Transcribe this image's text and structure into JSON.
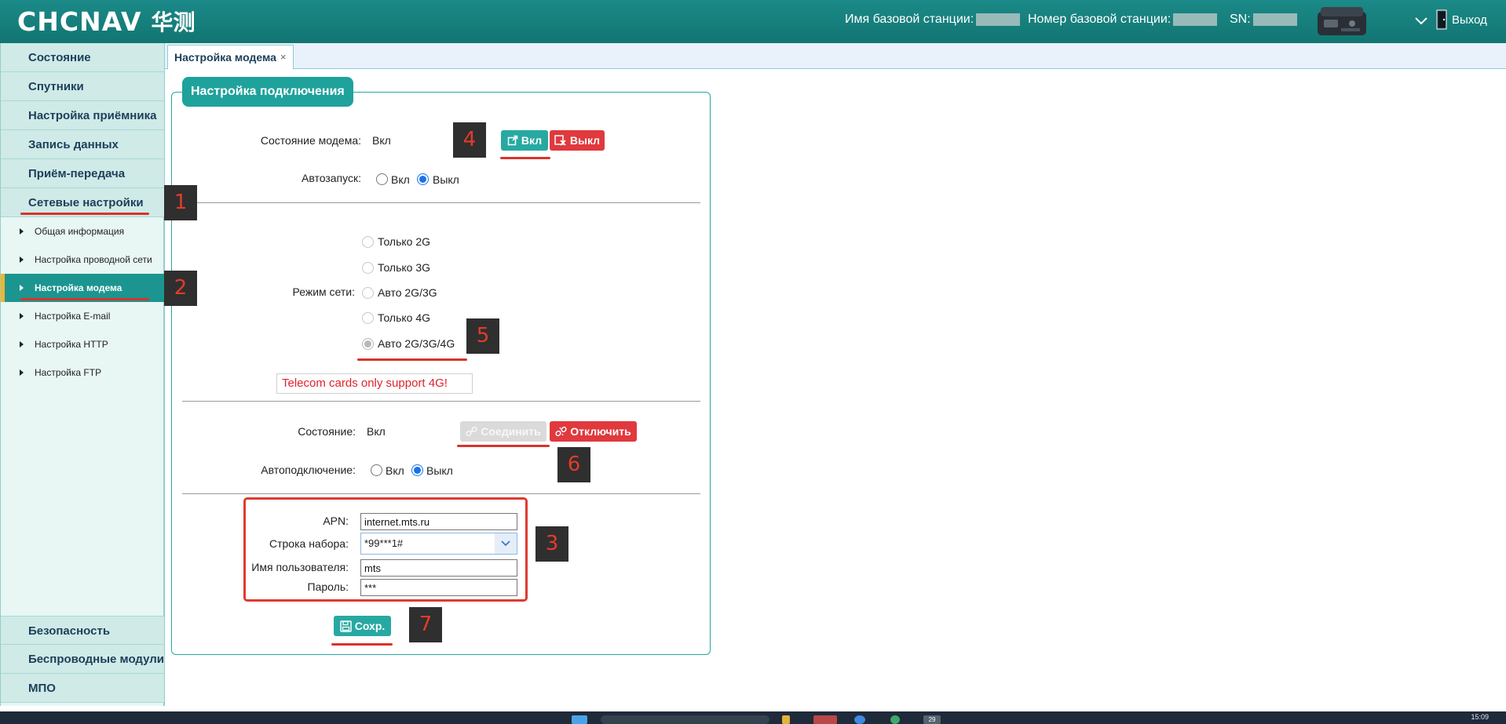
{
  "header": {
    "logo_text": "CHCNAV",
    "logo_cn": "华测",
    "base_name_label": "Имя базовой станции:",
    "base_number_label": "Номер базовой станции:",
    "sn_label": "SN:",
    "logout_label": "Выход"
  },
  "sidebar": {
    "top_items": [
      {
        "label": "Состояние"
      },
      {
        "label": "Спутники"
      },
      {
        "label": "Настройка приёмника"
      },
      {
        "label": "Запись данных"
      },
      {
        "label": "Приём-передача"
      },
      {
        "label": "Сетевые настройки"
      }
    ],
    "sub_items": [
      {
        "label": "Общая информация"
      },
      {
        "label": "Настройка проводной сети"
      },
      {
        "label": "Настройка модема",
        "active": true
      },
      {
        "label": "Настройка E-mail"
      },
      {
        "label": "Настройка HTTP"
      },
      {
        "label": "Настройка FTP"
      }
    ],
    "bottom_items": [
      {
        "label": "Безопасность"
      },
      {
        "label": "Беспроводные модули"
      },
      {
        "label": "МПО"
      }
    ]
  },
  "tabs": [
    {
      "label": "Настройка модема",
      "close": "×"
    }
  ],
  "panel": {
    "title": "Настройка подключения",
    "modem_state_label": "Состояние модема:",
    "modem_state_value": "Вкл",
    "btn_on": "Вкл",
    "btn_off": "Выкл",
    "autostart_label": "Автозапуск:",
    "autostart_on": "Вкл",
    "autostart_off": "Выкл",
    "autostart_selected": "Выкл",
    "network_mode_label": "Режим сети:",
    "network_modes": [
      {
        "label": "Только 2G",
        "checked": false
      },
      {
        "label": "Только 3G",
        "checked": false
      },
      {
        "label": "Авто 2G/3G",
        "checked": false
      },
      {
        "label": "Только 4G",
        "checked": false
      },
      {
        "label": "Авто 2G/3G/4G",
        "checked": true
      }
    ],
    "telecom_warning": "Telecom cards only support 4G!",
    "connection_state_label": "Состояние:",
    "connection_state_value": "Вкл",
    "btn_connect": "Соединить",
    "btn_disconnect": "Отключить",
    "autoconnect_label": "Автоподключение:",
    "autoconnect_on": "Вкл",
    "autoconnect_off": "Выкл",
    "autoconnect_selected": "Выкл",
    "apn_label": "APN:",
    "apn_value": "internet.mts.ru",
    "dial_label": "Строка набора:",
    "dial_value": "*99***1#",
    "username_label": "Имя пользователя:",
    "username_value": "mts",
    "password_label": "Пароль:",
    "password_value": "***",
    "btn_save": "Сохр."
  },
  "annotations": [
    "1",
    "2",
    "3",
    "4",
    "5",
    "6",
    "7"
  ],
  "taskbar": {
    "time": "15:09",
    "notification_count": "29"
  },
  "colors": {
    "header_bg": "#1b8a88",
    "accent_teal": "#27a9a2",
    "danger_red": "#e0393e",
    "active_sidebar": "#1c9590",
    "annotation_red": "#e53a2c"
  }
}
